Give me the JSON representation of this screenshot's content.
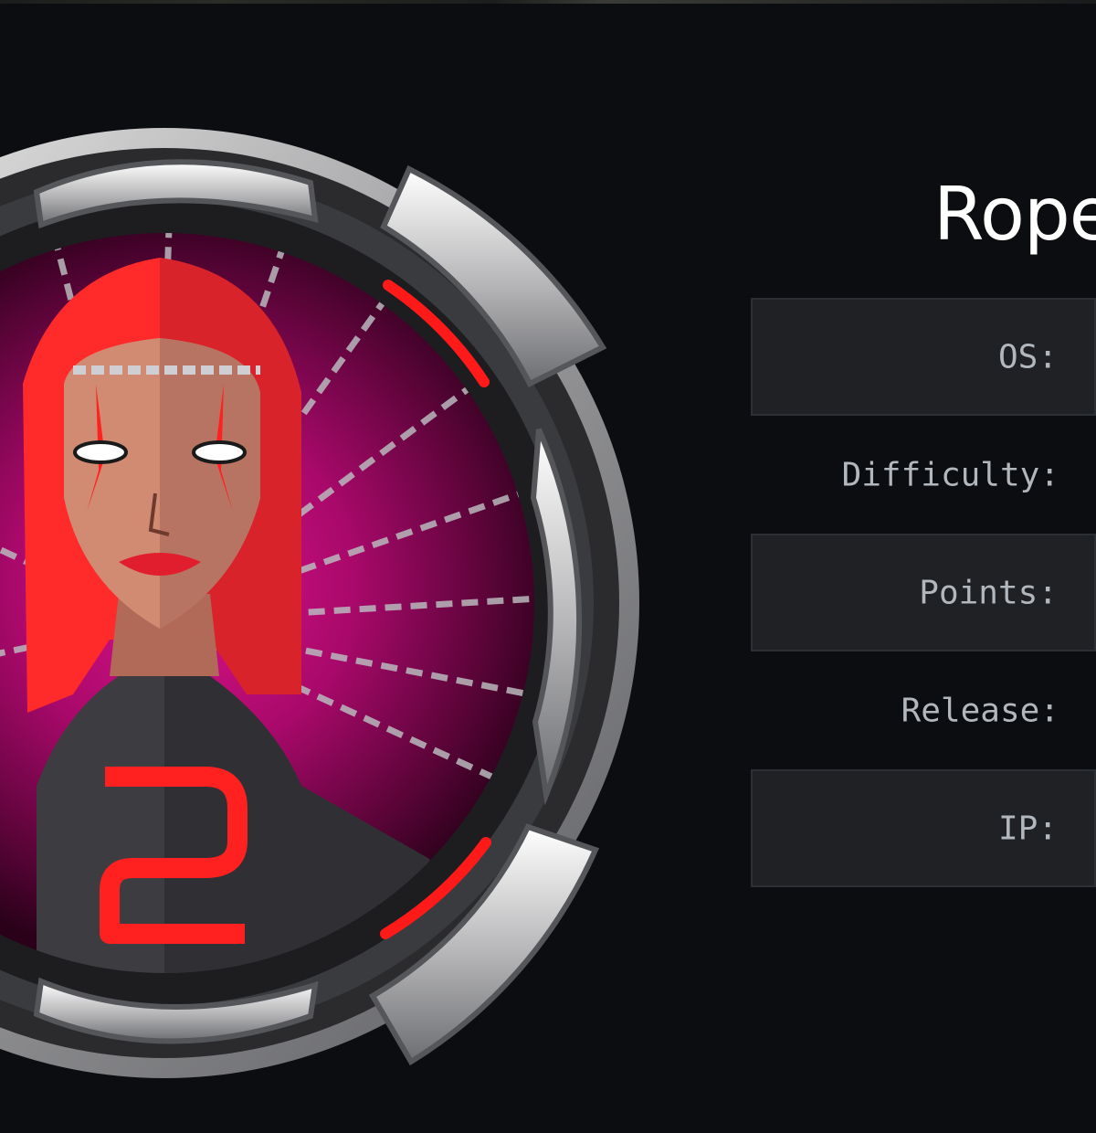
{
  "machine": {
    "name": "Rope"
  },
  "info": {
    "rows": [
      {
        "label": "OS:"
      },
      {
        "label": "Difficulty:"
      },
      {
        "label": "Points:"
      },
      {
        "label": "Release:"
      },
      {
        "label": "IP:"
      }
    ]
  },
  "avatar": {
    "icon": "hacker-woman-avatar-icon",
    "badge_number": "2",
    "colors": {
      "hair": "#ff2a2a",
      "background": "#8a0850",
      "ring": "#c9c9cb",
      "accent": "#ff1a1a"
    }
  }
}
